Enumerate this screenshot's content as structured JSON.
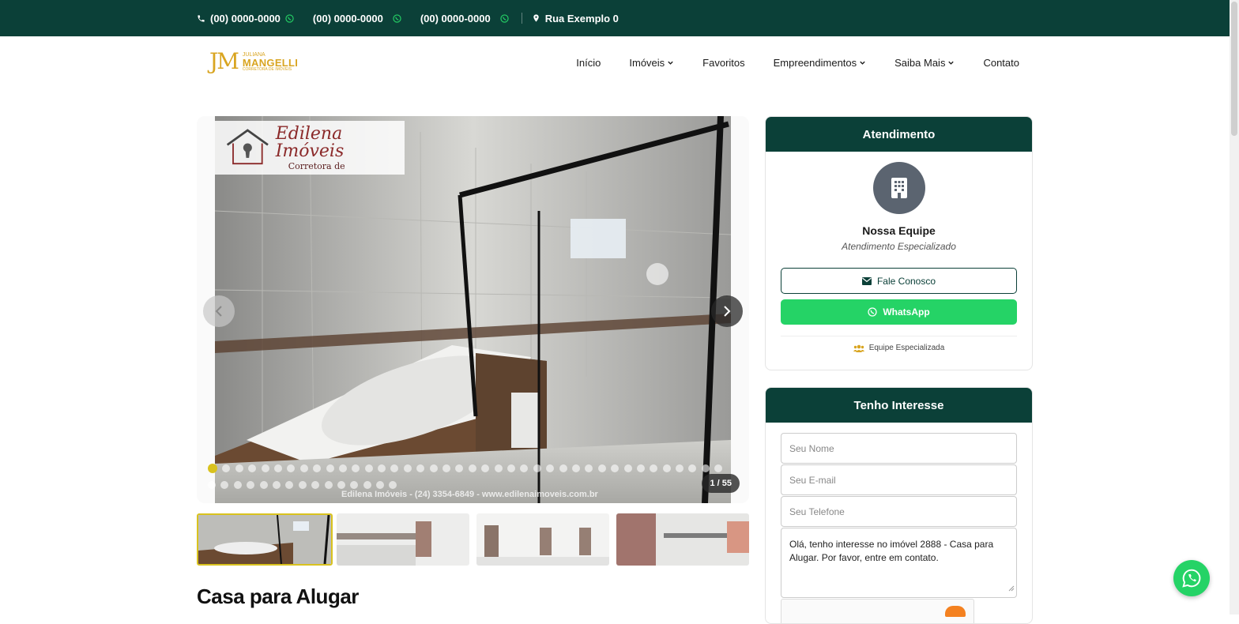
{
  "topbar": {
    "phones": [
      "(00) 0000-0000",
      "(00) 0000-0000",
      "(00) 0000-0000"
    ],
    "address": "Rua Exemplo 0"
  },
  "logo": {
    "initials": "JM",
    "name_top": "JULIANA",
    "name_main": "MANGELLI",
    "tagline": "CORRETORA DE IMÓVEIS"
  },
  "nav": {
    "items": [
      {
        "label": "Início",
        "has_dropdown": false
      },
      {
        "label": "Imóveis",
        "has_dropdown": true
      },
      {
        "label": "Favoritos",
        "has_dropdown": false
      },
      {
        "label": "Empreendimentos",
        "has_dropdown": true
      },
      {
        "label": "Saiba Mais",
        "has_dropdown": true
      },
      {
        "label": "Contato",
        "has_dropdown": false
      }
    ]
  },
  "gallery": {
    "watermark_brand": "Edilena Imóveis",
    "watermark_sub": "Corretora de",
    "watermark_footer": "Edilena Imóveis - (24) 3354-6849 - www.edilenaimoveis.com.br",
    "counter": "1 / 55",
    "total_photos": 55,
    "current_index": 1
  },
  "property": {
    "title": "Casa para Alugar"
  },
  "atendimento": {
    "heading": "Atendimento",
    "agent_name": "Nossa Equipe",
    "agent_subtitle": "Atendimento Especializado",
    "contact_button": "Fale Conosco",
    "whatsapp_button": "WhatsApp",
    "team_label": "Equipe Especializada"
  },
  "interest_form": {
    "heading": "Tenho Interesse",
    "name_placeholder": "Seu Nome",
    "email_placeholder": "Seu E-mail",
    "phone_placeholder": "Seu Telefone",
    "message": "Olá, tenho interesse no imóvel 2888 - Casa para Alugar. Por favor, entre em contato."
  },
  "colors": {
    "primary": "#0b4038",
    "accent": "#d9a521",
    "whatsapp": "#25d366"
  }
}
